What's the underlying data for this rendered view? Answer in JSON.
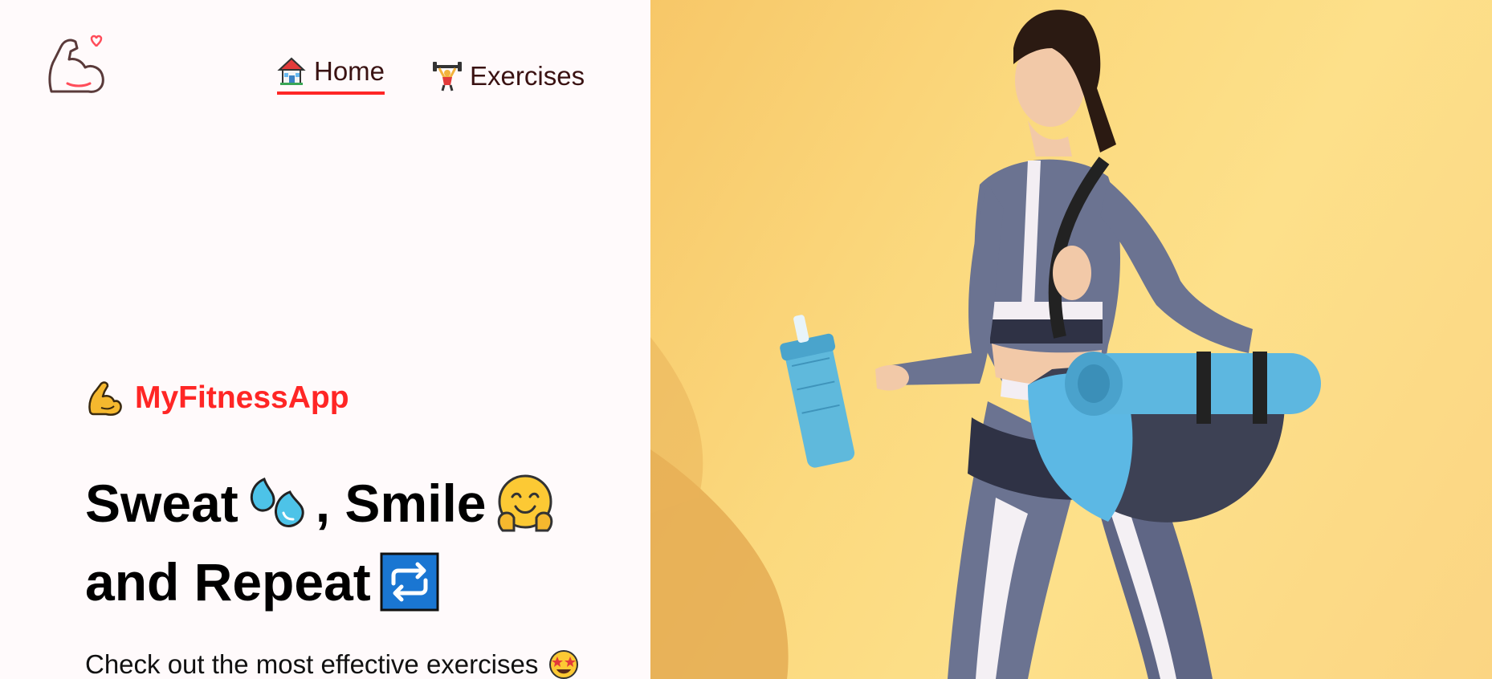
{
  "nav": {
    "home_label": "Home",
    "home_icon": "house-icon",
    "exercises_label": "Exercises",
    "exercises_icon": "weightlifter-icon",
    "active": "Home",
    "active_color": "#ff2625"
  },
  "logo": {
    "icon": "flexed-arm-heart-icon"
  },
  "hero": {
    "brand_icon": "flexed-biceps-icon",
    "brand_name": "MyFitnessApp",
    "brand_color": "#ff2625",
    "headline_line1_part1": "Sweat",
    "headline_line1_part2": ", Smile",
    "headline_line2": "and Repeat",
    "headline_icons": [
      "sweat-droplets-icon",
      "hugging-face-icon",
      "repeat-icon"
    ],
    "subtext": "Check out the most effective exercises",
    "subtext_icon": "star-struck-icon",
    "image": "woman-with-gym-bag-and-shaker-photo"
  }
}
